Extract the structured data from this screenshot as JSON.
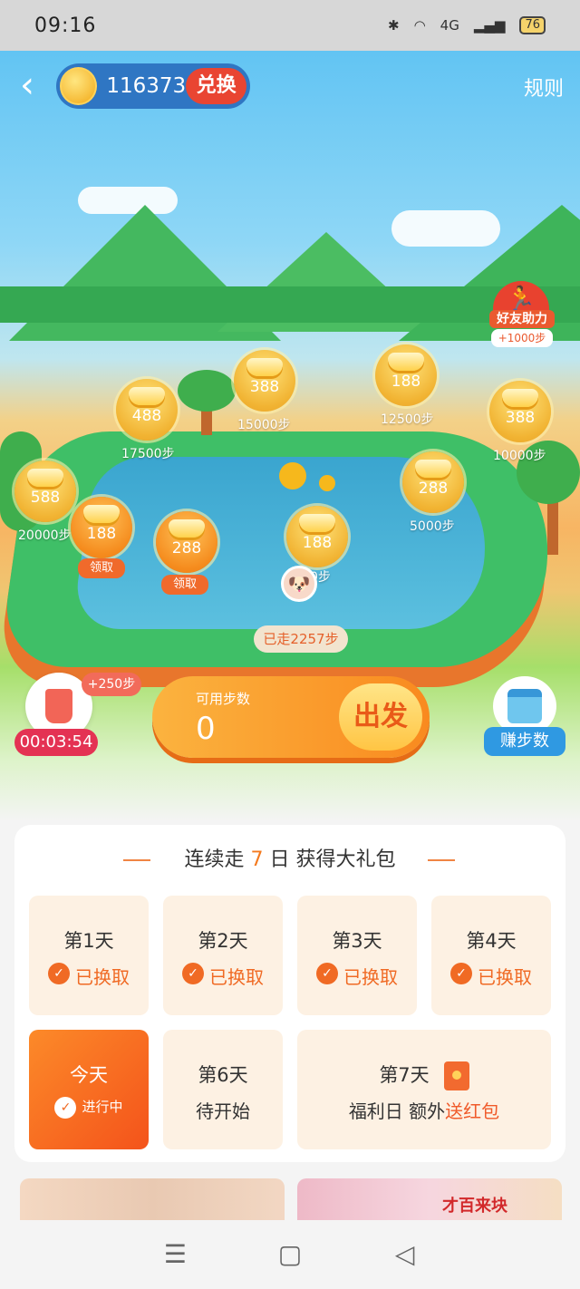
{
  "status_bar": {
    "time": "09:16",
    "network": "4G",
    "battery": "76"
  },
  "header": {
    "coin_balance": "116373",
    "exchange_label": "兑换",
    "rules_label": "规则"
  },
  "friend_help": {
    "label": "好友助力",
    "bonus": "+1000步"
  },
  "map": {
    "bubbles": [
      {
        "value": "388",
        "step": "15000步"
      },
      {
        "value": "188",
        "step": "12500步"
      },
      {
        "value": "488",
        "step": "17500步"
      },
      {
        "value": "388",
        "step": "10000步"
      },
      {
        "value": "588",
        "step": "20000步"
      },
      {
        "value": "288",
        "step": "5000步"
      },
      {
        "value": "188",
        "claim": "领取"
      },
      {
        "value": "288",
        "claim": "领取"
      },
      {
        "value": "188",
        "step": "0步"
      }
    ],
    "walked": "已走2257步"
  },
  "timer": {
    "bonus": "+250步",
    "countdown": "00:03:54"
  },
  "start": {
    "label": "可用步数",
    "value": "0",
    "go": "出发"
  },
  "earn": {
    "label": "赚步数"
  },
  "streak": {
    "title_prefix": "连续走",
    "title_days": "7",
    "title_suffix": "日 获得大礼包",
    "days": [
      {
        "title": "第1天",
        "status": "已换取"
      },
      {
        "title": "第2天",
        "status": "已换取"
      },
      {
        "title": "第3天",
        "status": "已换取"
      },
      {
        "title": "第4天",
        "status": "已换取"
      }
    ],
    "today": {
      "title": "今天",
      "status": "进行中"
    },
    "day6": {
      "title": "第6天",
      "status": "待开始"
    },
    "day7": {
      "title": "第7天",
      "status_prefix": "福利日 额外",
      "status_highlight": "送红包"
    }
  },
  "promo": {
    "right_text": "才百来块"
  }
}
